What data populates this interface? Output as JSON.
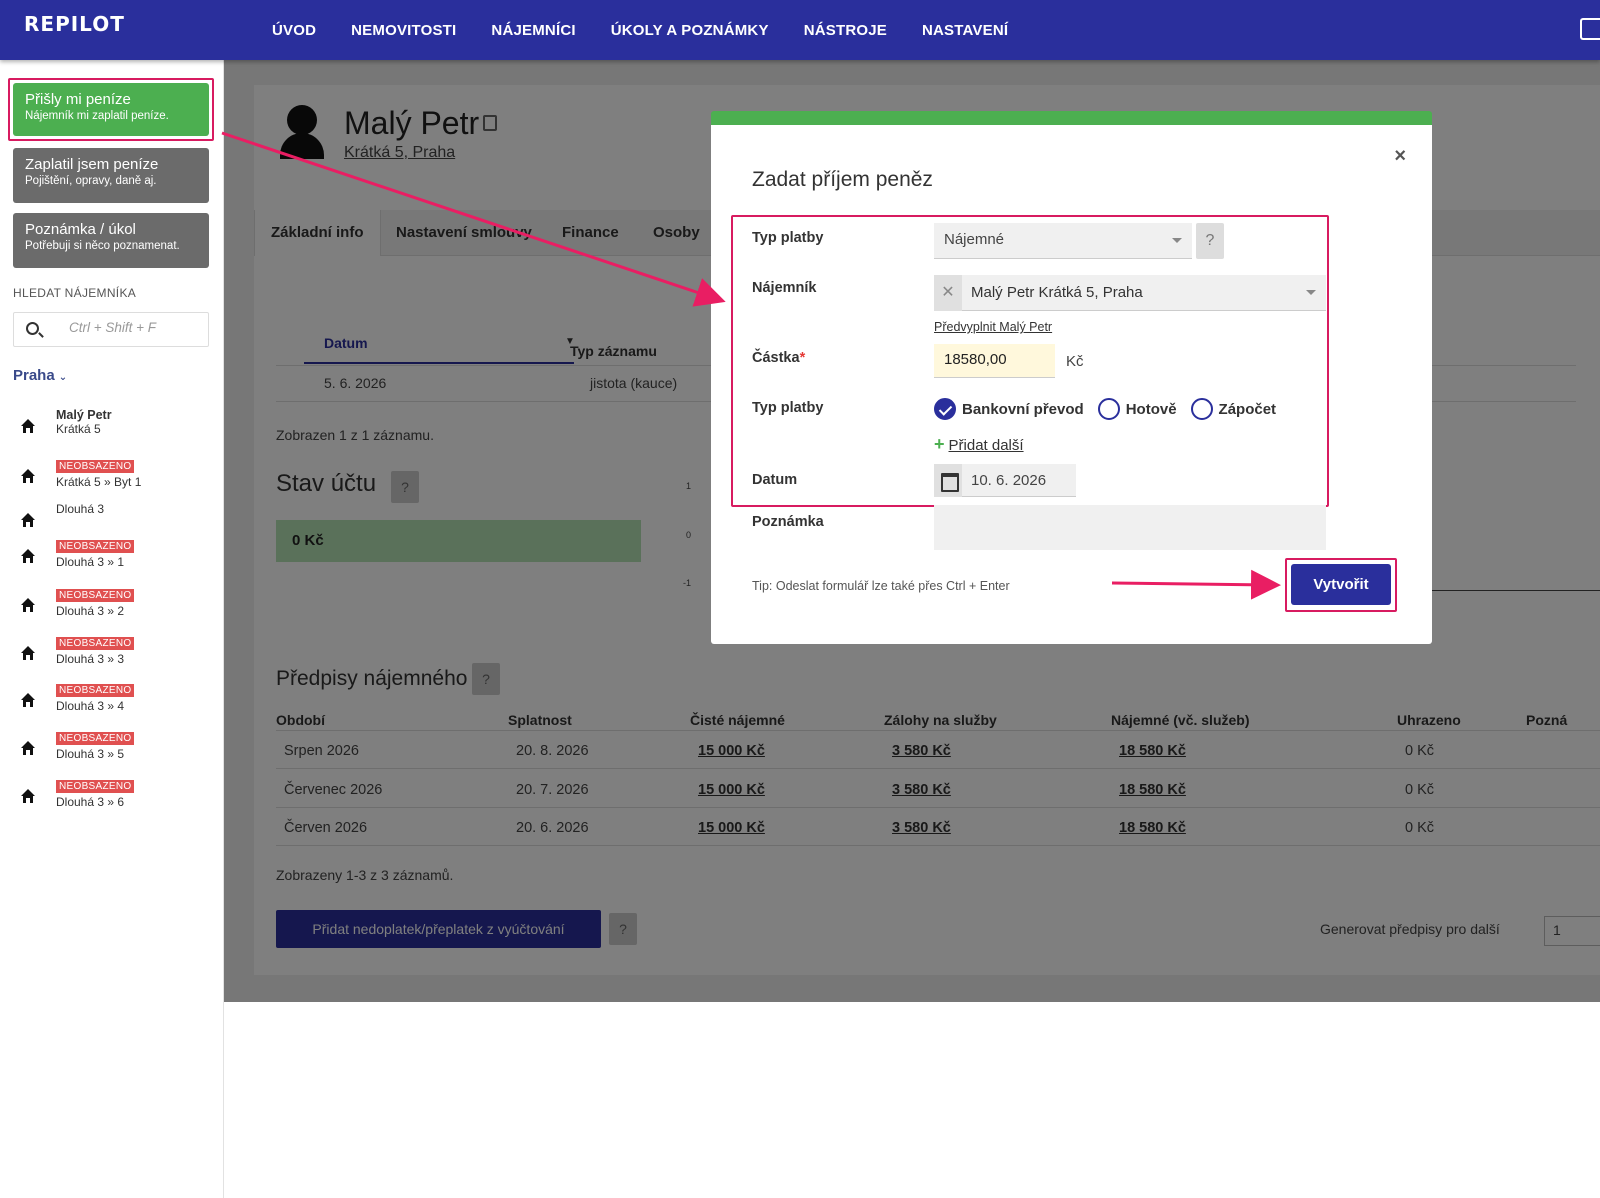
{
  "app": {
    "logo": "REPILOT",
    "nav": [
      "ÚVOD",
      "NEMOVITOSTI",
      "NÁJEMNÍCI",
      "ÚKOLY A POZNÁMKY",
      "NÁSTROJE",
      "NASTAVENÍ"
    ]
  },
  "sidebar": {
    "actions": [
      {
        "title": "Přišly mi peníze",
        "subtitle": "Nájemník mi zaplatil peníze."
      },
      {
        "title": "Zaplatil jsem peníze",
        "subtitle": "Pojištění, opravy, daně aj."
      },
      {
        "title": "Poznámka / úkol",
        "subtitle": "Potřebuji si něco poznamenat."
      }
    ],
    "search_label": "HLEDAT NÁJEMNÍKA",
    "search_placeholder": "Ctrl + Shift + F",
    "city": "Praha",
    "tenants": [
      {
        "badge": "",
        "name": "Malý Petr",
        "address": "Krátká 5"
      },
      {
        "badge": "NEOBSAZENO",
        "name": "",
        "address": "Krátká 5 » Byt 1"
      },
      {
        "badge": "",
        "name": "",
        "address": "Dlouhá 3"
      },
      {
        "badge": "NEOBSAZENO",
        "name": "",
        "address": "Dlouhá 3 » 1"
      },
      {
        "badge": "NEOBSAZENO",
        "name": "",
        "address": "Dlouhá 3 » 2"
      },
      {
        "badge": "NEOBSAZENO",
        "name": "",
        "address": "Dlouhá 3 » 3"
      },
      {
        "badge": "NEOBSAZENO",
        "name": "",
        "address": "Dlouhá 3 » 4"
      },
      {
        "badge": "NEOBSAZENO",
        "name": "",
        "address": "Dlouhá 3 » 5"
      },
      {
        "badge": "NEOBSAZENO",
        "name": "",
        "address": "Dlouhá 3 » 6"
      }
    ]
  },
  "page": {
    "name": "Malý Petr",
    "address": "Krátká 5, Praha",
    "tabs": [
      "Základní info",
      "Nastavení smlouvy",
      "Finance",
      "Osoby"
    ],
    "records": {
      "col_date": "Datum",
      "col_type": "Typ záznamu",
      "row_date": "5. 6. 2026",
      "row_type": "jistota (kauce)",
      "shown": "Zobrazen 1 z 1 záznamu."
    },
    "balance_title": "Stav účtu",
    "help": "?",
    "balance_value": "0 Kč",
    "axis": [
      "1",
      "0",
      "-1"
    ],
    "rent_title": "Předpisy nájemného",
    "rent_columns": [
      "Období",
      "Splatnost",
      "Čisté nájemné",
      "Zálohy na služby",
      "Nájemné (vč. služeb)",
      "Uhrazeno",
      "Pozná"
    ],
    "rent_rows": [
      {
        "period": "Srpen 2026",
        "due": "20. 8. 2026",
        "net": "15 000 Kč",
        "services": "3 580 Kč",
        "total": "18 580 Kč",
        "paid": "0 Kč"
      },
      {
        "period": "Červenec 2026",
        "due": "20. 7. 2026",
        "net": "15 000 Kč",
        "services": "3 580 Kč",
        "total": "18 580 Kč",
        "paid": "0 Kč"
      },
      {
        "period": "Červen 2026",
        "due": "20. 6. 2026",
        "net": "15 000 Kč",
        "services": "3 580 Kč",
        "total": "18 580 Kč",
        "paid": "0 Kč"
      }
    ],
    "rent_shown": "Zobrazeny 1-3 z 3 záznamů.",
    "add_button": "Přidat nedoplatek/přeplatek z vyúčtování",
    "generate_label": "Generovat předpisy pro další",
    "generate_value": "1"
  },
  "modal": {
    "title": "Zadat příjem peněz",
    "close": "×",
    "label_payment_type": "Typ platby",
    "payment_type_value": "Nájemné",
    "label_tenant": "Nájemník",
    "tenant_value": "Malý Petr Krátká 5, Praha",
    "prefill_link": "Předvyplnit Malý Petr",
    "label_amount": "Částka",
    "required_mark": "*",
    "amount_value": "18580,00",
    "currency": "Kč",
    "label_method": "Typ platby",
    "methods": [
      "Bankovní převod",
      "Hotově",
      "Zápočet"
    ],
    "method_selected": "Bankovní převod",
    "add_more": "Přidat další",
    "label_date": "Datum",
    "date_value": "10. 6. 2026",
    "label_note": "Poznámka",
    "tip": "Tip: Odeslat formulář lze také přes Ctrl + Enter",
    "submit": "Vytvořit"
  },
  "colors": {
    "nav": "#2a2f9c",
    "success": "#4caf50",
    "highlight": "#d81b60",
    "badge": "#e05050"
  }
}
